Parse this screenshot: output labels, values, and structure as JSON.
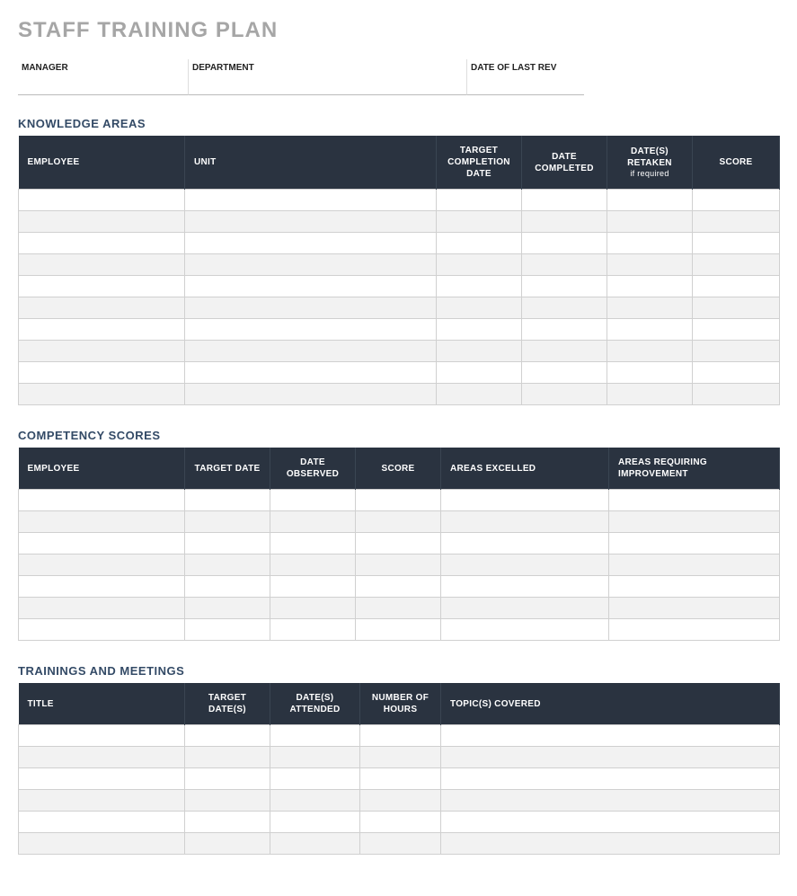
{
  "title": "STAFF TRAINING PLAN",
  "meta": {
    "manager_label": "MANAGER",
    "manager_value": "",
    "department_label": "DEPARTMENT",
    "department_value": "",
    "date_label": "DATE OF LAST REV",
    "date_value": ""
  },
  "sections": {
    "knowledge": {
      "title": "KNOWLEDGE AREAS",
      "headers": {
        "employee": "EMPLOYEE",
        "unit": "UNIT",
        "target_date": "TARGET COMPLETION DATE",
        "completed": "DATE COMPLETED",
        "retaken": "DATE(S) RETAKEN",
        "retaken_sub": "if required",
        "score": "SCORE"
      },
      "rows": [
        {
          "employee": "",
          "unit": "",
          "target_date": "",
          "completed": "",
          "retaken": "",
          "score": ""
        },
        {
          "employee": "",
          "unit": "",
          "target_date": "",
          "completed": "",
          "retaken": "",
          "score": ""
        },
        {
          "employee": "",
          "unit": "",
          "target_date": "",
          "completed": "",
          "retaken": "",
          "score": ""
        },
        {
          "employee": "",
          "unit": "",
          "target_date": "",
          "completed": "",
          "retaken": "",
          "score": ""
        },
        {
          "employee": "",
          "unit": "",
          "target_date": "",
          "completed": "",
          "retaken": "",
          "score": ""
        },
        {
          "employee": "",
          "unit": "",
          "target_date": "",
          "completed": "",
          "retaken": "",
          "score": ""
        },
        {
          "employee": "",
          "unit": "",
          "target_date": "",
          "completed": "",
          "retaken": "",
          "score": ""
        },
        {
          "employee": "",
          "unit": "",
          "target_date": "",
          "completed": "",
          "retaken": "",
          "score": ""
        },
        {
          "employee": "",
          "unit": "",
          "target_date": "",
          "completed": "",
          "retaken": "",
          "score": ""
        },
        {
          "employee": "",
          "unit": "",
          "target_date": "",
          "completed": "",
          "retaken": "",
          "score": ""
        }
      ]
    },
    "competency": {
      "title": "COMPETENCY SCORES",
      "headers": {
        "employee": "EMPLOYEE",
        "target_date": "TARGET DATE",
        "observed": "DATE OBSERVED",
        "score": "SCORE",
        "excelled": "AREAS EXCELLED",
        "improve": "AREAS REQUIRING IMPROVEMENT"
      },
      "rows": [
        {
          "employee": "",
          "target_date": "",
          "observed": "",
          "score": "",
          "excelled": "",
          "improve": ""
        },
        {
          "employee": "",
          "target_date": "",
          "observed": "",
          "score": "",
          "excelled": "",
          "improve": ""
        },
        {
          "employee": "",
          "target_date": "",
          "observed": "",
          "score": "",
          "excelled": "",
          "improve": ""
        },
        {
          "employee": "",
          "target_date": "",
          "observed": "",
          "score": "",
          "excelled": "",
          "improve": ""
        },
        {
          "employee": "",
          "target_date": "",
          "observed": "",
          "score": "",
          "excelled": "",
          "improve": ""
        },
        {
          "employee": "",
          "target_date": "",
          "observed": "",
          "score": "",
          "excelled": "",
          "improve": ""
        },
        {
          "employee": "",
          "target_date": "",
          "observed": "",
          "score": "",
          "excelled": "",
          "improve": ""
        }
      ]
    },
    "trainings": {
      "title": "TRAININGS AND MEETINGS",
      "headers": {
        "title": "TITLE",
        "target_dates": "TARGET DATE(S)",
        "attended": "DATE(S) ATTENDED",
        "hours": "NUMBER OF HOURS",
        "topics": "TOPIC(S) COVERED"
      },
      "rows": [
        {
          "title": "",
          "target_dates": "",
          "attended": "",
          "hours": "",
          "topics": ""
        },
        {
          "title": "",
          "target_dates": "",
          "attended": "",
          "hours": "",
          "topics": ""
        },
        {
          "title": "",
          "target_dates": "",
          "attended": "",
          "hours": "",
          "topics": ""
        },
        {
          "title": "",
          "target_dates": "",
          "attended": "",
          "hours": "",
          "topics": ""
        },
        {
          "title": "",
          "target_dates": "",
          "attended": "",
          "hours": "",
          "topics": ""
        },
        {
          "title": "",
          "target_dates": "",
          "attended": "",
          "hours": "",
          "topics": ""
        }
      ]
    }
  }
}
